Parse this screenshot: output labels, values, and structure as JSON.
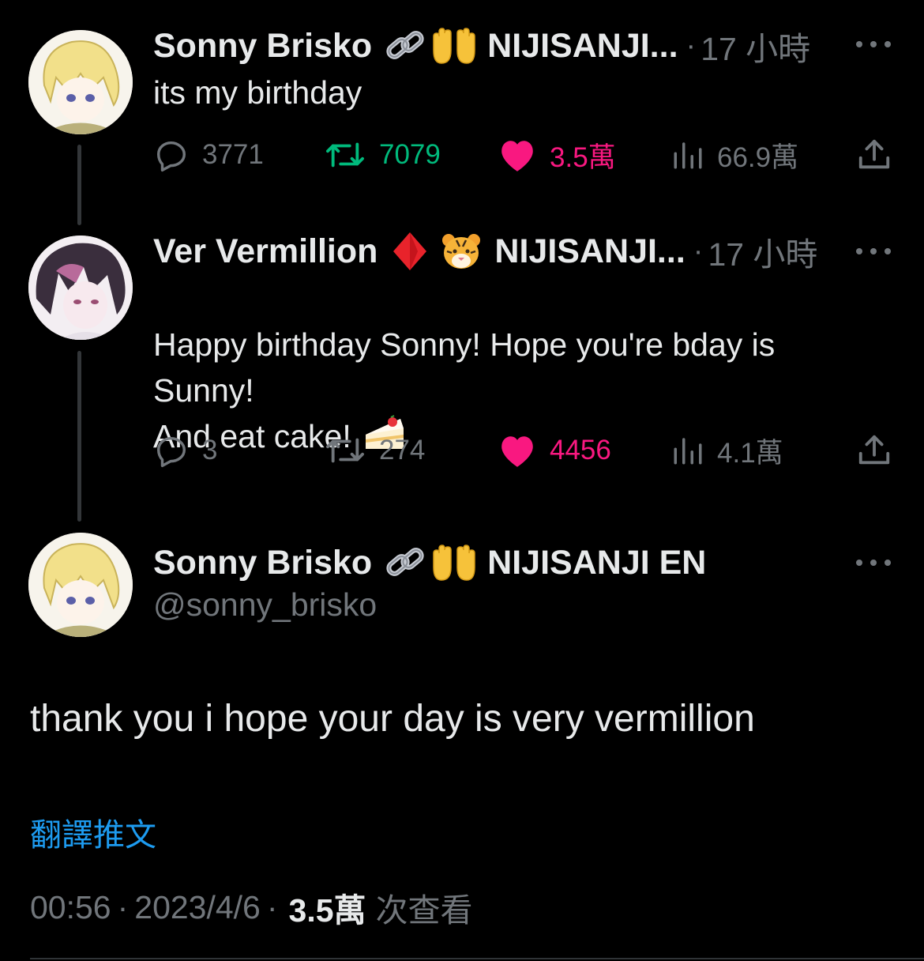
{
  "thread": [
    {
      "name": "Sonny Brisko",
      "org": "NIJISANJI...",
      "time": "17 小時",
      "text": "its my birthday",
      "stats": {
        "replies": "3771",
        "retweets": "7079",
        "likes": "3.5萬",
        "views": "66.9萬"
      },
      "emojis": [
        "link-icon",
        "raised-hands-icon"
      ]
    },
    {
      "name": "Ver Vermillion",
      "org": "NIJISANJI...",
      "time": "17 小時",
      "text": "Happy birthday Sonny! Hope you're bday is\nSunny!\nAnd eat cake!",
      "stats": {
        "replies": "3",
        "retweets": "274",
        "likes": "4456",
        "views": "4.1萬"
      },
      "emojis": [
        "diamond-icon",
        "tiger-icon",
        "cake-icon"
      ]
    }
  ],
  "main_tweet": {
    "name": "Sonny Brisko",
    "org": "NIJISANJI EN",
    "handle": "@sonny_brisko",
    "text": "thank you i hope your day is very vermillion",
    "translate_label": "翻譯推文",
    "time": "00:56",
    "date": "2023/4/6",
    "views": "3.5萬",
    "views_label": "次查看"
  },
  "colors": {
    "background": "#000000",
    "text": "#e7e9ea",
    "muted": "#71767b",
    "retweet": "#00ba7c",
    "like": "#f91880",
    "link": "#1d9bf0"
  }
}
